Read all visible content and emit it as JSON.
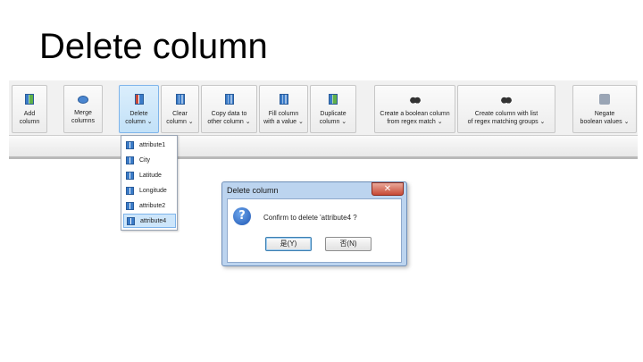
{
  "slide": {
    "title": "Delete column"
  },
  "toolbar": {
    "buttons": [
      {
        "label": "Add\ncolumn",
        "icon": "column-icon"
      },
      {
        "label": "Merge\ncolumns",
        "icon": "merge-icon"
      },
      {
        "label": "Delete\ncolumn ⌄",
        "icon": "column-delete-icon"
      },
      {
        "label": "Clear\ncolumn ⌄",
        "icon": "column-icon"
      },
      {
        "label": "Copy data to\nother column ⌄",
        "icon": "column-icon"
      },
      {
        "label": "Fill column\nwith a value ⌄",
        "icon": "column-icon"
      },
      {
        "label": "Duplicate\ncolumn ⌄",
        "icon": "column-add-icon"
      },
      {
        "label": "Create a boolean column\nfrom regex match ⌄",
        "icon": "binoculars-icon"
      },
      {
        "label": "Create column with list\nof regex matching groups ⌄",
        "icon": "binoculars-icon"
      },
      {
        "label": "Negate\nboolean values ⌄",
        "icon": "negate-icon"
      }
    ]
  },
  "dropdown": {
    "items": [
      "attribute1",
      "City",
      "Latitude",
      "Longitude",
      "attribute2",
      "attribute4"
    ],
    "highlighted_index": 5
  },
  "dialog": {
    "title": "Delete column",
    "close_label": "✕",
    "message": "Confirm to delete 'attribute4 ?",
    "yes_label": "是(Y)",
    "no_label": "否(N)"
  }
}
